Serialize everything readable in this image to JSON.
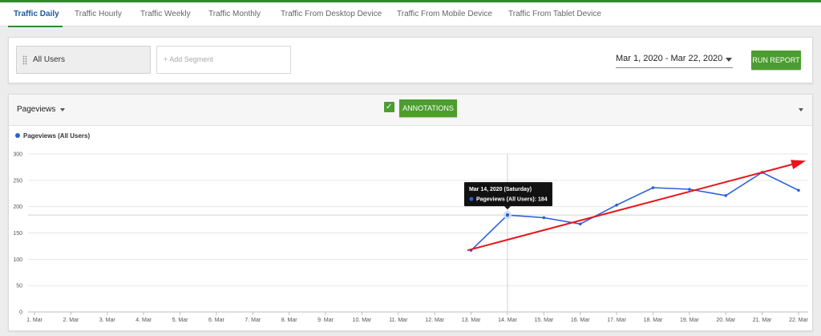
{
  "tabs": [
    {
      "label": "Traffic Daily",
      "active": true
    },
    {
      "label": "Traffic Hourly",
      "active": false
    },
    {
      "label": "Traffic Weekly",
      "active": false
    },
    {
      "label": "Traffic Monthly",
      "active": false
    },
    {
      "label": "Traffic From Desktop Device",
      "active": false
    },
    {
      "label": "Traffic From Mobile Device",
      "active": false
    },
    {
      "label": "Traffic From Tablet Device",
      "active": false
    }
  ],
  "segments": {
    "selected": "All Users",
    "add_placeholder": "+ Add Segment"
  },
  "date_range": "Mar 1, 2020 - Mar 22, 2020",
  "run_report_label": "RUN REPORT",
  "metric_label": "Pageviews",
  "annotations_label": "ANNOTATIONS",
  "colors": {
    "accent_green": "#4c9d2f",
    "series_blue": "#2b5fd9",
    "trend_red": "#e8151b"
  },
  "tooltip": {
    "date": "Mar 14, 2020 (Saturday)",
    "series": "Pageviews (All Users)",
    "value": "184"
  },
  "chart_data": {
    "type": "line",
    "x": [
      "1. Mar",
      "2. Mar",
      "3. Mar",
      "4. Mar",
      "5. Mar",
      "6. Mar",
      "7. Mar",
      "8. Mar",
      "9. Mar",
      "10. Mar",
      "11. Mar",
      "12. Mar",
      "13. Mar",
      "14. Mar",
      "15. Mar",
      "16. Mar",
      "17. Mar",
      "18. Mar",
      "19. Mar",
      "20. Mar",
      "21. Mar",
      "22. Mar"
    ],
    "series": [
      {
        "name": "Pageviews (All Users)",
        "values": [
          null,
          null,
          null,
          null,
          null,
          null,
          null,
          null,
          null,
          null,
          null,
          null,
          117,
          184,
          179,
          167,
          203,
          236,
          233,
          221,
          265,
          231
        ]
      }
    ],
    "ylim": [
      0,
      300
    ],
    "yticks": [
      0,
      50,
      100,
      150,
      200,
      250,
      300
    ],
    "grid": true,
    "legend": "top-left",
    "trend_arrow": {
      "from": {
        "x": 12.9,
        "y": 117
      },
      "to": {
        "x": 22.2,
        "y": 287
      }
    }
  }
}
